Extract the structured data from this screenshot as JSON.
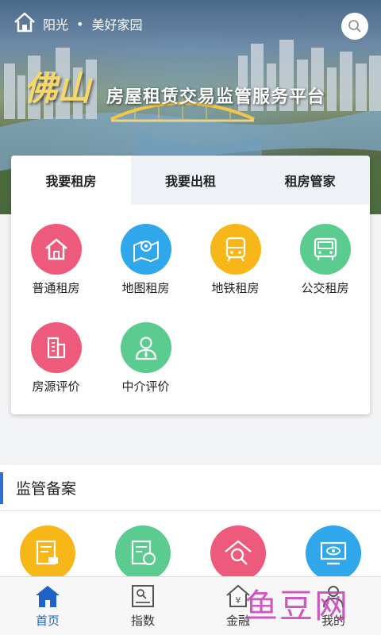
{
  "header": {
    "location_city": "阳光",
    "location_separator": "•",
    "location_community": "美好家园"
  },
  "banner": {
    "logo_text": "佛山",
    "title": "房屋租赁交易监管服务平台"
  },
  "tabs": [
    {
      "label": "我要租房",
      "active": true
    },
    {
      "label": "我要出租",
      "active": false
    },
    {
      "label": "租房管家",
      "active": false
    }
  ],
  "services": [
    {
      "label": "普通租房",
      "icon": "house-icon",
      "color": "#ee5a7c"
    },
    {
      "label": "地图租房",
      "icon": "map-pin-icon",
      "color": "#2fa7ea"
    },
    {
      "label": "地铁租房",
      "icon": "subway-icon",
      "color": "#f7b718"
    },
    {
      "label": "公交租房",
      "icon": "bus-icon",
      "color": "#5bcb90"
    },
    {
      "label": "房源评价",
      "icon": "building-icon",
      "color": "#ee5a7c"
    },
    {
      "label": "中介评价",
      "icon": "agent-icon",
      "color": "#5bcb90"
    }
  ],
  "supervision": {
    "title": "监管备案",
    "icons": [
      {
        "icon": "contract-stamp-icon",
        "color": "#f7b718"
      },
      {
        "icon": "document-badge-icon",
        "color": "#5bcb90"
      },
      {
        "icon": "house-search-icon",
        "color": "#ee5a7c"
      },
      {
        "icon": "monitor-eye-icon",
        "color": "#2fa7ea"
      }
    ]
  },
  "bottom_nav": [
    {
      "label": "首页",
      "icon": "home-icon",
      "active": true
    },
    {
      "label": "指数",
      "icon": "index-chart-icon",
      "active": false
    },
    {
      "label": "金融",
      "icon": "finance-house-icon",
      "active": false
    },
    {
      "label": "我的",
      "icon": "profile-icon",
      "active": false
    }
  ],
  "watermark": "鱼豆网",
  "colors": {
    "accent_blue": "#1f62c7",
    "section_bar": "#2f6fd0",
    "logo_gold": "#f6d86a"
  }
}
